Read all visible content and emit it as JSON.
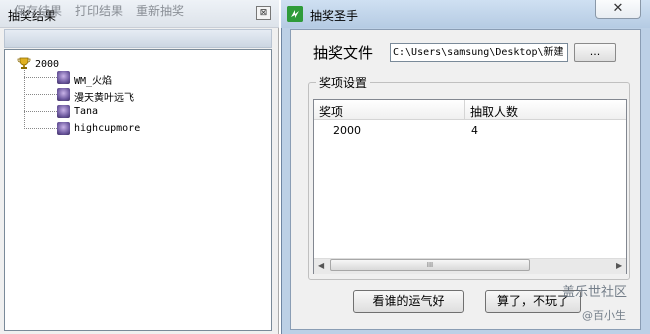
{
  "left_window": {
    "title": "抽奖结果",
    "close_glyph": "⊠",
    "toolbar": {
      "save": "保存结果",
      "print": "打印结果",
      "redraw": "重新抽奖"
    },
    "tree": {
      "root": "2000",
      "root_icon": "trophy-icon",
      "winners": [
        "WM_火焰",
        "漫天黄叶远飞",
        "Tana",
        "highcupmore"
      ]
    }
  },
  "right_window": {
    "title": "抽奖圣手",
    "app_icon": "four-leaf-icon",
    "close_glyph": "✕",
    "file_label": "抽奖文件",
    "file_path": "C:\\Users\\samsung\\Desktop\\新建",
    "browse_label": "...",
    "group_label": "奖项设置",
    "list": {
      "headers": [
        "奖项",
        "抽取人数"
      ],
      "rows": [
        {
          "prize": "2000",
          "count": "4"
        }
      ]
    },
    "scroll_grip": "III",
    "lucky_button": "看谁的运气好",
    "quit_button": "算了，不玩了"
  },
  "watermark": {
    "line1": "盖乐世社区",
    "line2": "@百小生"
  }
}
